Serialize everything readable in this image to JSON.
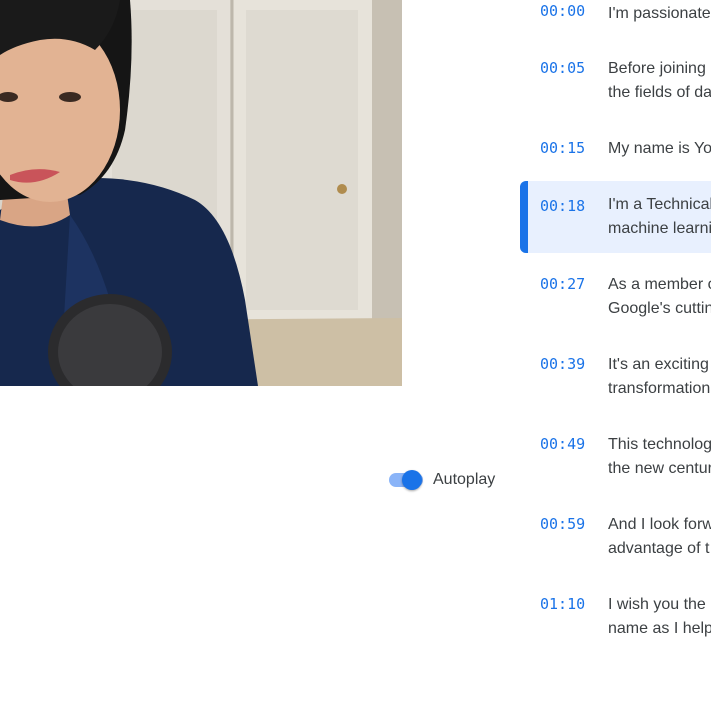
{
  "video": {
    "label": "Video player"
  },
  "autoplay": {
    "label": "Autoplay",
    "enabled": true,
    "accent": "#1a73e8"
  },
  "transcript": {
    "active_index": 3,
    "entries": [
      {
        "time": "00:00",
        "line1": "I'm passionate",
        "line2": ""
      },
      {
        "time": "00:05",
        "line1": "Before joining",
        "line2": "the fields of da"
      },
      {
        "time": "00:15",
        "line1": "My name is Yo",
        "line2": ""
      },
      {
        "time": "00:18",
        "line1": "I'm a Technical",
        "line2": "machine learni"
      },
      {
        "time": "00:27",
        "line1": "As a member o",
        "line2": "Google's cuttin"
      },
      {
        "time": "00:39",
        "line1": "It's an exciting",
        "line2": "transformation"
      },
      {
        "time": "00:49",
        "line1": "This technolog",
        "line2": "the new centur"
      },
      {
        "time": "00:59",
        "line1": "And I look forw",
        "line2": "advantage of t"
      },
      {
        "time": "01:10",
        "line1": "I wish you the l",
        "line2": "name as I help"
      }
    ]
  }
}
